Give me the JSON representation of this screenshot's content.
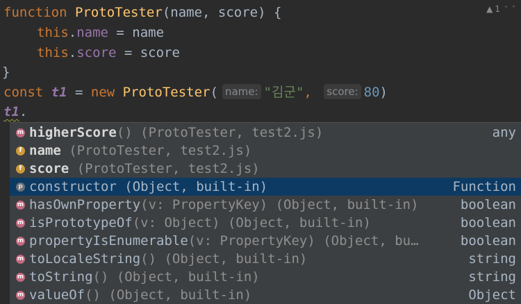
{
  "editor": {
    "warning_count": "1",
    "lines": {
      "l1": {
        "kw": "function",
        "fn": "ProtoTester",
        "params": "(name, score) {"
      },
      "l2": {
        "this": "this",
        "dot": ".",
        "prop": "name",
        "rest": " = name"
      },
      "l3": {
        "this": "this",
        "dot": ".",
        "prop": "score",
        "rest": " = score"
      },
      "l4": {
        "brace": "}"
      },
      "l5": {
        "const": "const",
        "var": "t1",
        "eq": " = ",
        "new": "new",
        "fn": "ProtoTester",
        "open": "(",
        "hint1": "name:",
        "str": "\"김군\"",
        "comma": ",",
        "hint2": "score:",
        "num": "80",
        "close": ")"
      },
      "l6": {
        "var": "t1",
        "dot": "."
      }
    }
  },
  "completion": {
    "items": [
      {
        "kind": "m",
        "name": "higherScore",
        "tail": "() (ProtoTester, test2.js)",
        "type": "any",
        "bold": true
      },
      {
        "kind": "f",
        "name": "name",
        "tail": " (ProtoTester, test2.js)",
        "type": "",
        "bold": true
      },
      {
        "kind": "f",
        "name": "score",
        "tail": " (ProtoTester, test2.js)",
        "type": "",
        "bold": true
      },
      {
        "kind": "p",
        "name": "constructor",
        "tail": " (Object, built-in)",
        "type": "Function",
        "bold": false
      },
      {
        "kind": "m",
        "name": "hasOwnProperty",
        "tail": "(v: PropertyKey) (Object, built-in)",
        "type": "boolean",
        "bold": false
      },
      {
        "kind": "m",
        "name": "isPrototypeOf",
        "tail": "(v: Object) (Object, built-in)",
        "type": "boolean",
        "bold": false
      },
      {
        "kind": "m",
        "name": "propertyIsEnumerable",
        "tail": "(v: PropertyKey) (Object, bu…",
        "type": "boolean",
        "bold": false
      },
      {
        "kind": "m",
        "name": "toLocaleString",
        "tail": "() (Object, built-in)",
        "type": "string",
        "bold": false
      },
      {
        "kind": "m",
        "name": "toString",
        "tail": "() (Object, built-in)",
        "type": "string",
        "bold": false
      },
      {
        "kind": "m",
        "name": "valueOf",
        "tail": "() (Object, built-in)",
        "type": "Object",
        "bold": false
      }
    ],
    "selected_index": 3
  },
  "colors": {
    "background": "#2b2b2b",
    "popup": "#3c3f41",
    "selection": "#0d3a63",
    "keyword": "#cc7832",
    "function": "#ffc66d",
    "property": "#9876aa",
    "string": "#6a8759",
    "number": "#6897bb"
  }
}
